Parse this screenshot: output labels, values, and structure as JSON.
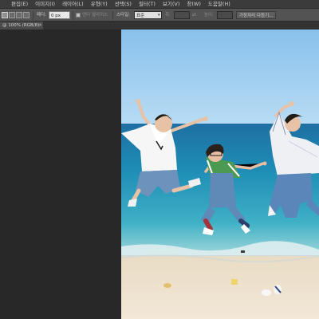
{
  "menu": {
    "items": [
      "편집(E)",
      "이미지(I)",
      "레이어(L)",
      "유형(Y)",
      "선택(S)",
      "필터(T)",
      "보기(V)",
      "창(W)",
      "도움말(H)"
    ]
  },
  "options": {
    "feather_label": "페더:",
    "feather_value": "0 px",
    "antialias_label": "앤티 앨리어스",
    "style_label": "스타일:",
    "style_value": "표준",
    "width_label": "폭:",
    "height_label": "높이:",
    "refine_button": "가장자리 다듬기..."
  },
  "document_tab": {
    "title": "@ 100% (RGB/8)",
    "close": "×"
  },
  "colors": {
    "menubar": "#3b3b3b",
    "optionsbar": "#535353",
    "workspace": "#282828",
    "sky": "#9ecdf0",
    "sea": "#1d89b0",
    "sand": "#ede2cf"
  }
}
